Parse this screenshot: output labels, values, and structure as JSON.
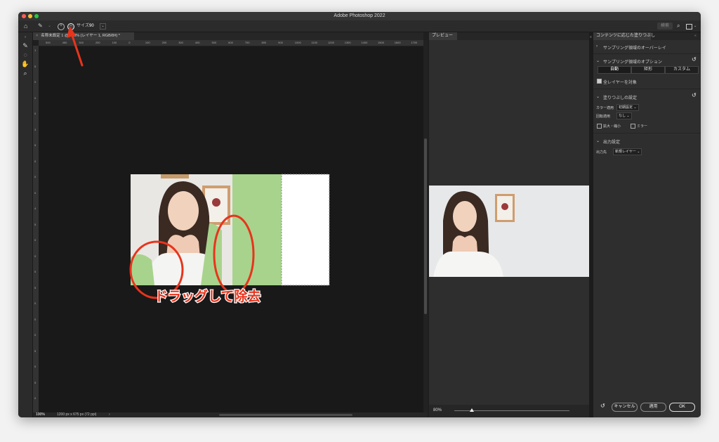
{
  "window": {
    "title": "Adobe Photoshop 2022"
  },
  "options_bar": {
    "size_label": "サイズ",
    "size_value": "90",
    "search_label": "検索"
  },
  "document": {
    "tab_title": "名称未設定 1 @ 100% (レイヤー 1, RGB/8#) *",
    "zoom": "100%",
    "doc_info": "1200 px x 675 px (72 ppi)"
  },
  "ruler": {
    "h_ticks": [
      "500",
      "450",
      "300",
      "200",
      "100",
      "0",
      "100",
      "200",
      "300",
      "400",
      "500",
      "600",
      "700",
      "800",
      "900",
      "1000",
      "1100",
      "1200",
      "1300",
      "1400",
      "1500",
      "1600",
      "1700"
    ],
    "v_ticks": [
      "1",
      "5",
      "0",
      "0",
      "0",
      "3",
      "5",
      "0",
      "0",
      "0",
      "4",
      "5",
      "0",
      "0",
      "0",
      "5",
      "0",
      "0",
      "0",
      "5",
      "0",
      "5",
      "0"
    ]
  },
  "preview": {
    "label": "プレビュー",
    "zoom": "80%",
    "zoom_level": 0.15
  },
  "panel": {
    "title": "コンテンツに応じた塗りつぶし",
    "overlay_label": "サンプリング領域のオーバーレイ",
    "sampling_options_label": "サンプリング領域のオプション",
    "sampling_buttons": [
      "自動",
      "矩形",
      "カスタム"
    ],
    "sample_all_layers": "全レイヤーを対象",
    "fill_settings_label": "塗りつぶしの設定",
    "color_adapt_label": "カラー適用",
    "color_adapt_value": "初期設定",
    "rotation_label": "回転適用",
    "rotation_value": "なし",
    "scale_label": "拡大・縮小",
    "mirror_label": "ミラー",
    "output_settings_label": "出力設定",
    "output_to_label": "出力先",
    "output_to_value": "新規レイヤー",
    "cancel": "キャンセル",
    "apply": "適用",
    "ok": "OK"
  },
  "annotation": {
    "text": "ドラッグして除去",
    "color": "#e8341c"
  },
  "colors": {
    "accent_red": "#e8341c",
    "green_fill": "#a8d38d"
  }
}
